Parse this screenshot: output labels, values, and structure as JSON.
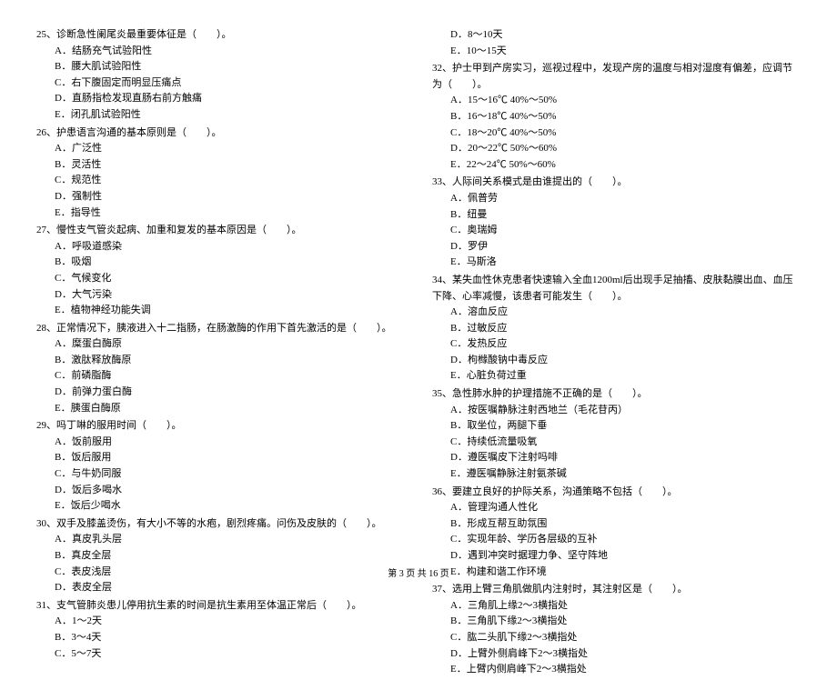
{
  "left": {
    "q25": {
      "text": "25、诊断急性阑尾炎最重要体征是（　　）。",
      "a": "A．结肠充气试验阳性",
      "b": "B．腰大肌试验阳性",
      "c": "C．右下腹固定而明显压痛点",
      "d": "D．直肠指检发现直肠右前方触痛",
      "e": "E．闭孔肌试验阳性"
    },
    "q26": {
      "text": "26、护患语言沟通的基本原则是（　　）。",
      "a": "A．广泛性",
      "b": "B．灵活性",
      "c": "C．规范性",
      "d": "D．强制性",
      "e": "E．指导性"
    },
    "q27": {
      "text": "27、慢性支气管炎起病、加重和复发的基本原因是（　　）。",
      "a": "A．呼吸道感染",
      "b": "B．吸烟",
      "c": "C．气候变化",
      "d": "D．大气污染",
      "e": "E．植物神经功能失调"
    },
    "q28": {
      "text": "28、正常情况下，胰液进入十二指肠，在肠激酶的作用下首先激活的是（　　）。",
      "a": "A．糜蛋白酶原",
      "b": "B．激肽释放酶原",
      "c": "C．前磷脂酶",
      "d": "D．前弹力蛋白酶",
      "e": "E．胰蛋白酶原"
    },
    "q29": {
      "text": "29、吗丁啉的服用时间（　　）。",
      "a": "A．饭前服用",
      "b": "B．饭后服用",
      "c": "C．与牛奶同服",
      "d": "D．饭后多喝水",
      "e": "E．饭后少喝水"
    },
    "q30": {
      "text": "30、双手及膝盖烫伤，有大小不等的水疱，剧烈疼痛。问伤及皮肤的（　　）。",
      "a": "A．真皮乳头层",
      "b": "B．真皮全层",
      "c": "C．表皮浅层",
      "d": "D．表皮全层"
    },
    "q31": {
      "text": "31、支气管肺炎患儿停用抗生素的时间是抗生素用至体温正常后（　　）。",
      "a": "A．1～2天",
      "b": "B．3～4天",
      "c": "C．5～7天"
    }
  },
  "right": {
    "q31r": {
      "d": "D．8～10天",
      "e": "E．10～15天"
    },
    "q32": {
      "text": "32、护士甲到产房实习，巡视过程中，发现产房的温度与相对湿度有偏差，应调节为（　　）。",
      "a": "A．15～16℃ 40%～50%",
      "b": "B．16～18℃ 40%～50%",
      "c": "C．18～20℃ 40%～50%",
      "d": "D．20～22℃ 50%～60%",
      "e": "E．22～24℃ 50%～60%"
    },
    "q33": {
      "text": "33、人际间关系模式是由谁提出的（　　）。",
      "a": "A．佩普劳",
      "b": "B．纽曼",
      "c": "C．奥瑞姆",
      "d": "D．罗伊",
      "e": "E．马斯洛"
    },
    "q34": {
      "text": "34、某失血性休克患者快速输入全血1200ml后出现手足抽搐、皮肤黏膜出血、血压下降、心率减慢，该患者可能发生（　　）。",
      "a": "A．溶血反应",
      "b": "B．过敏反应",
      "c": "C．发热反应",
      "d": "D．枸橼酸钠中毒反应",
      "e": "E．心脏负荷过重"
    },
    "q35": {
      "text": "35、急性肺水肿的护理措施不正确的是（　　）。",
      "a": "A．按医嘱静脉注射西地兰（毛花苷丙）",
      "b": "B．取坐位，两腿下垂",
      "c": "C．持续低流量吸氧",
      "d": "D．遵医嘱皮下注射吗啡",
      "e": "E．遵医嘱静脉注射氨茶碱"
    },
    "q36": {
      "text": "36、要建立良好的护际关系，沟通策略不包括（　　）。",
      "a": "A．管理沟通人性化",
      "b": "B．形成互帮互助氛围",
      "c": "C．实现年龄、学历各层级的互补",
      "d": "D．遇到冲突时据理力争、坚守阵地",
      "e": "E．构建和谐工作环境"
    },
    "q37": {
      "text": "37、选用上臂三角肌做肌内注射时，其注射区是（　　）。",
      "a": "A．三角肌上缘2～3横指处",
      "b": "B．三角肌下缘2～3横指处",
      "c": "C．肱二头肌下缘2～3横指处",
      "d": "D．上臂外侧肩峰下2～3横指处",
      "e": "E．上臂内侧肩峰下2～3横指处"
    }
  },
  "footer": "第 3 页 共 16 页"
}
